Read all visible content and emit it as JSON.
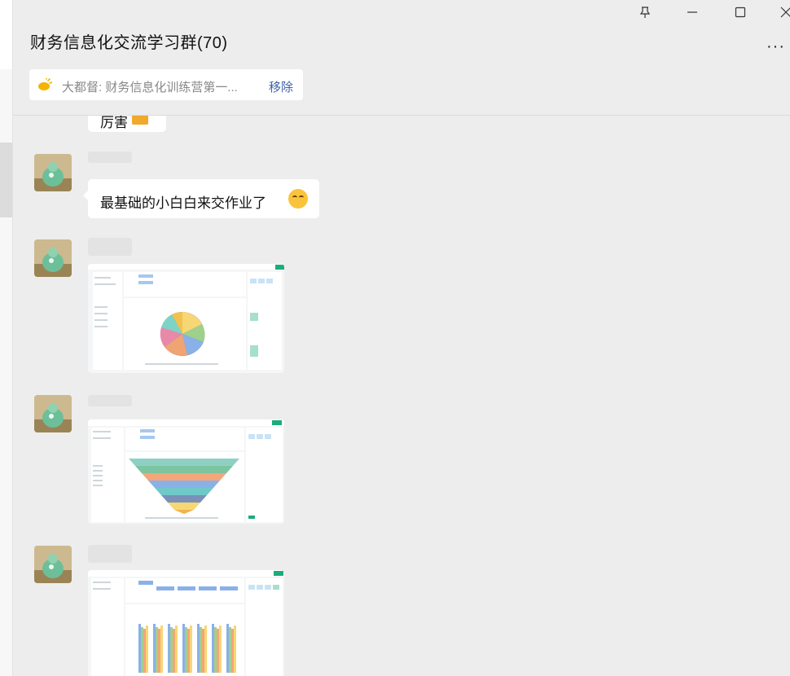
{
  "window": {
    "title": "财务信息化交流学习群(70)",
    "pin_glyph": "⊥",
    "minimize_glyph": "—",
    "maximize_glyph": "☐",
    "close_glyph": "✕",
    "more_glyph": "···"
  },
  "pinned": {
    "text": "大都督: 财务信息化训练营第一...",
    "remove_label": "移除",
    "icon": "megaphone-icon"
  },
  "messages": [
    {
      "type": "text",
      "text": "厉害",
      "partial": true
    },
    {
      "type": "text",
      "text": "最基础的小白白来交作业了"
    },
    {
      "type": "image",
      "content": "pie-chart-screenshot"
    },
    {
      "type": "image",
      "content": "funnel-chart-screenshot"
    },
    {
      "type": "image",
      "content": "bar-chart-screenshot"
    }
  ],
  "colors": {
    "background": "#ededed",
    "bubble": "#ffffff",
    "link": "#3e62a8",
    "accent": "#1aad7a"
  }
}
